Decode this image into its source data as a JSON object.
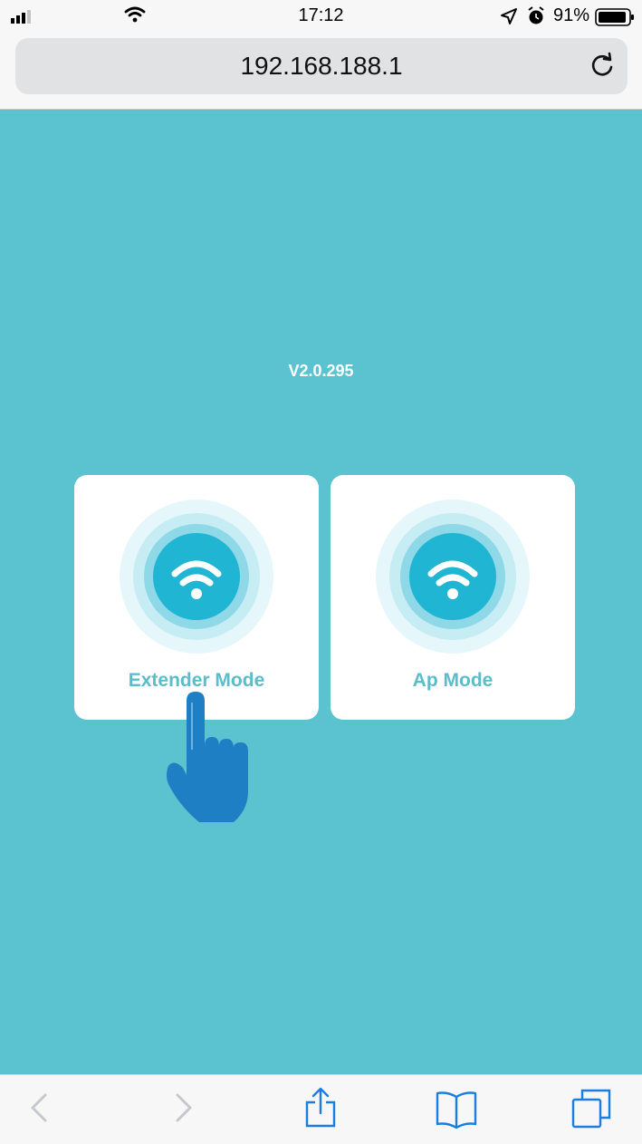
{
  "status_bar": {
    "time": "17:12",
    "battery_percent": "91%",
    "icons": [
      "signal-icon",
      "wifi-icon",
      "location-icon",
      "alarm-icon",
      "battery-icon"
    ]
  },
  "browser": {
    "url": "192.168.188.1",
    "reload_icon": "reload-icon"
  },
  "page": {
    "version": "V2.0.295",
    "modes": [
      {
        "label": "Extender Mode",
        "icon": "wifi-icon"
      },
      {
        "label": "Ap Mode",
        "icon": "wifi-icon"
      }
    ],
    "pointer_icon": "hand-pointer-icon"
  },
  "toolbar": {
    "icons": [
      "back-icon",
      "forward-icon",
      "share-icon",
      "bookmarks-icon",
      "tabs-icon"
    ]
  },
  "colors": {
    "background": "#5bc2cf",
    "card": "#ffffff",
    "label": "#5bbcca",
    "icon_core": "#1fb5d3",
    "hand": "#1e7fc4",
    "toolbar_icon": "#1a7ee0"
  }
}
